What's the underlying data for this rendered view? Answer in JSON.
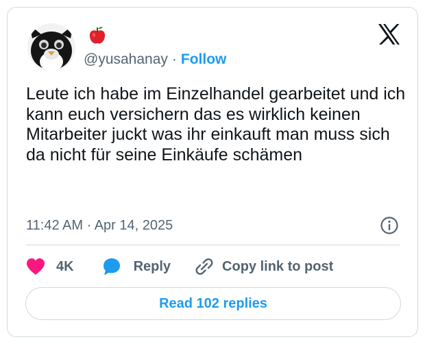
{
  "tweet": {
    "handle": "@yusahanay",
    "separator": "·",
    "follow_label": "Follow",
    "display_name_emoji": "red-apple-icon",
    "text": "Leute ich habe im Einzelhandel gearbeitet und ich kann euch versichern das es wirklich keinen Mitarbeiter juckt was ihr einkauft man muss sich da nicht für seine Einkäufe schämen",
    "timestamp": "11:42 AM · Apr 14, 2025"
  },
  "actions": {
    "like_count": "4K",
    "reply_label": "Reply",
    "copy_link_label": "Copy link to post"
  },
  "footer": {
    "read_replies_label": "Read 102 replies"
  },
  "icons": {
    "platform": "x-logo-icon",
    "avatar": "furby-avatar",
    "info": "info-icon",
    "like": "heart-icon",
    "reply": "reply-bubble-icon",
    "copy": "link-icon"
  },
  "colors": {
    "accent": "#1d9bf0",
    "like": "#f91880",
    "muted_text": "#536471",
    "text": "#0f1419",
    "border": "#cfd9de"
  }
}
